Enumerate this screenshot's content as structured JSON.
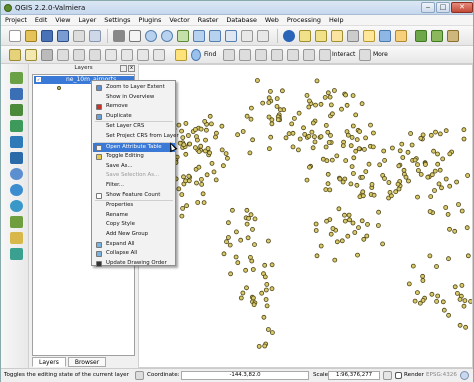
{
  "window": {
    "title": "QGIS 2.2.0-Valmiera",
    "minimize": "‒",
    "maximize": "□",
    "close": "✕"
  },
  "menubar": [
    "Project",
    "Edit",
    "View",
    "Layer",
    "Settings",
    "Plugins",
    "Vector",
    "Raster",
    "Database",
    "Web",
    "Processing",
    "Help"
  ],
  "toolbar2": {
    "find_label": "Find",
    "interact_label": "Interact",
    "more_label": "More"
  },
  "layers_panel": {
    "title": "Layers",
    "layer_name": "ne_10m_airports",
    "tabs": [
      "Layers",
      "Browser"
    ]
  },
  "context_menu": {
    "items": [
      {
        "label": "Zoom to Layer Extent",
        "icon": "zoom-layer-icon",
        "state": "normal"
      },
      {
        "label": "Show in Overview",
        "icon": "",
        "state": "normal"
      },
      {
        "label": "Remove",
        "icon": "remove-icon",
        "state": "normal"
      },
      {
        "label": "Duplicate",
        "icon": "duplicate-icon",
        "state": "normal"
      },
      {
        "label": "Set Layer CRS",
        "icon": "",
        "state": "normal"
      },
      {
        "label": "Set Project CRS from Layer",
        "icon": "",
        "state": "normal"
      },
      {
        "label": "Open Attribute Table",
        "icon": "table-icon",
        "state": "highlighted"
      },
      {
        "label": "Toggle Editing",
        "icon": "pencil-icon",
        "state": "normal"
      },
      {
        "label": "Save As...",
        "icon": "",
        "state": "normal"
      },
      {
        "label": "Save Selection As...",
        "icon": "",
        "state": "disabled"
      },
      {
        "label": "Filter...",
        "icon": "",
        "state": "normal"
      },
      {
        "label": "Show Feature Count",
        "icon": "checkbox-icon",
        "state": "normal"
      },
      {
        "label": "Properties",
        "icon": "",
        "state": "normal"
      },
      {
        "label": "Rename",
        "icon": "",
        "state": "normal"
      },
      {
        "label": "Copy Style",
        "icon": "",
        "state": "normal"
      },
      {
        "label": "Add New Group",
        "icon": "",
        "state": "normal"
      },
      {
        "label": "Expand All",
        "icon": "expand-icon",
        "state": "normal"
      },
      {
        "label": "Collapse All",
        "icon": "collapse-icon",
        "state": "normal"
      },
      {
        "label": "Update Drawing Order",
        "icon": "update-order-icon",
        "state": "normal"
      }
    ]
  },
  "statusbar": {
    "message": "Toggles the editing state of the current layer",
    "coordinate_label": "Coordinate:",
    "coordinate_value": "-144.3,82.0",
    "scale_label": "Scale",
    "scale_value": "1:96,376,277",
    "render_label": "Render",
    "crs_label": "EPSG:4326"
  },
  "colors": {
    "point_fill": "#d8c96a",
    "point_stroke": "#4d4418",
    "selection": "#3b79d6"
  }
}
